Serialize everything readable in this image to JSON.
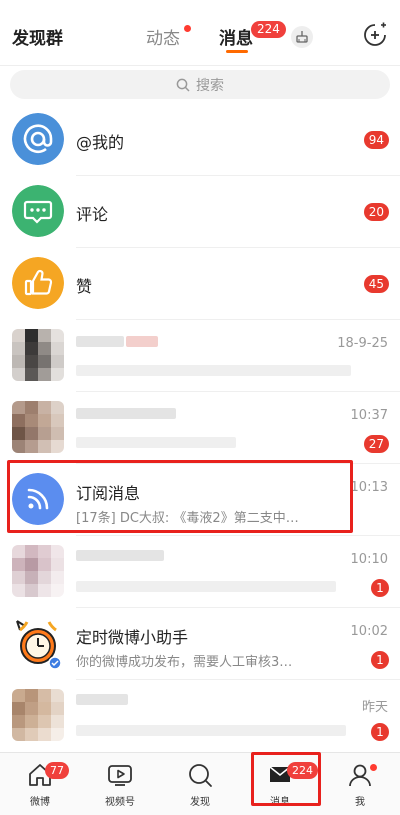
{
  "header": {
    "left_label": "发现群",
    "tabs": [
      {
        "label": "动态"
      },
      {
        "label": "消息"
      }
    ],
    "message_badge": "224"
  },
  "search": {
    "placeholder": "搜索"
  },
  "messages": [
    {
      "title": "@我的",
      "badge": "94",
      "icon": "at-icon",
      "color": "#4a90d9"
    },
    {
      "title": "评论",
      "badge": "20",
      "icon": "comment-icon",
      "color": "#3cb371"
    },
    {
      "title": "赞",
      "badge": "45",
      "icon": "thumbs-up-icon",
      "color": "#f5a623"
    },
    {
      "time": "18-9-25"
    },
    {
      "time": "10:37",
      "badge": "27"
    },
    {
      "title": "订阅消息",
      "subtitle": "[17条] DC大叔: 《毒液2》第二支中…",
      "time": "10:13",
      "icon": "rss-icon",
      "color": "#5b8def"
    },
    {
      "time": "10:10",
      "badge": "1"
    },
    {
      "title": "定时微博小助手",
      "subtitle": "你的微博成功发布，需要人工审核3…",
      "time": "10:02",
      "badge": "1",
      "icon": "alarm-clock-icon"
    },
    {
      "time": "昨天",
      "badge": "1"
    }
  ],
  "bottom_nav": [
    {
      "label": "微博",
      "badge": "77",
      "icon": "home-icon"
    },
    {
      "label": "视频号",
      "icon": "video-icon"
    },
    {
      "label": "发现",
      "icon": "discover-icon"
    },
    {
      "label": "消息",
      "badge": "224",
      "icon": "mail-icon"
    },
    {
      "label": "我",
      "icon": "profile-icon"
    }
  ],
  "colors": {
    "accent": "#ff6a00",
    "badge": "#e8392e",
    "highlight": "#e8211d"
  }
}
